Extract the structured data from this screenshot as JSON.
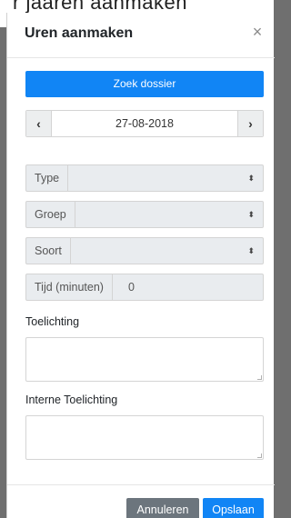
{
  "background": {
    "partial_text": "r jaaren aanmaken"
  },
  "modal": {
    "title": "Uren aanmaken",
    "close_glyph": "×",
    "search_button_label": "Zoek dossier",
    "date": {
      "prev_glyph": "‹",
      "value": "27-08-2018",
      "next_glyph": "›"
    },
    "selects": [
      {
        "label": "Type",
        "value": "",
        "arrow_glyph": "⬍"
      },
      {
        "label": "Groep",
        "value": "",
        "arrow_glyph": "⬍"
      },
      {
        "label": "Soort",
        "value": "",
        "arrow_glyph": "⬍"
      }
    ],
    "minutes": {
      "label": "Tijd (minuten)",
      "value": "0"
    },
    "toelichting": {
      "label": "Toelichting",
      "value": ""
    },
    "interne_toelichting": {
      "label": "Interne Toelichting",
      "value": ""
    },
    "footer": {
      "cancel_label": "Annuleren",
      "save_label": "Opslaan"
    }
  },
  "colors": {
    "primary": "#1185f5",
    "secondary": "#6c757d",
    "addon_bg": "#e9ecef",
    "overlay": "#6f6f6f"
  },
  "icons": {
    "close": "close-icon",
    "prev": "chevron-left-icon",
    "next": "chevron-right-icon",
    "select": "select-arrows-icon"
  }
}
